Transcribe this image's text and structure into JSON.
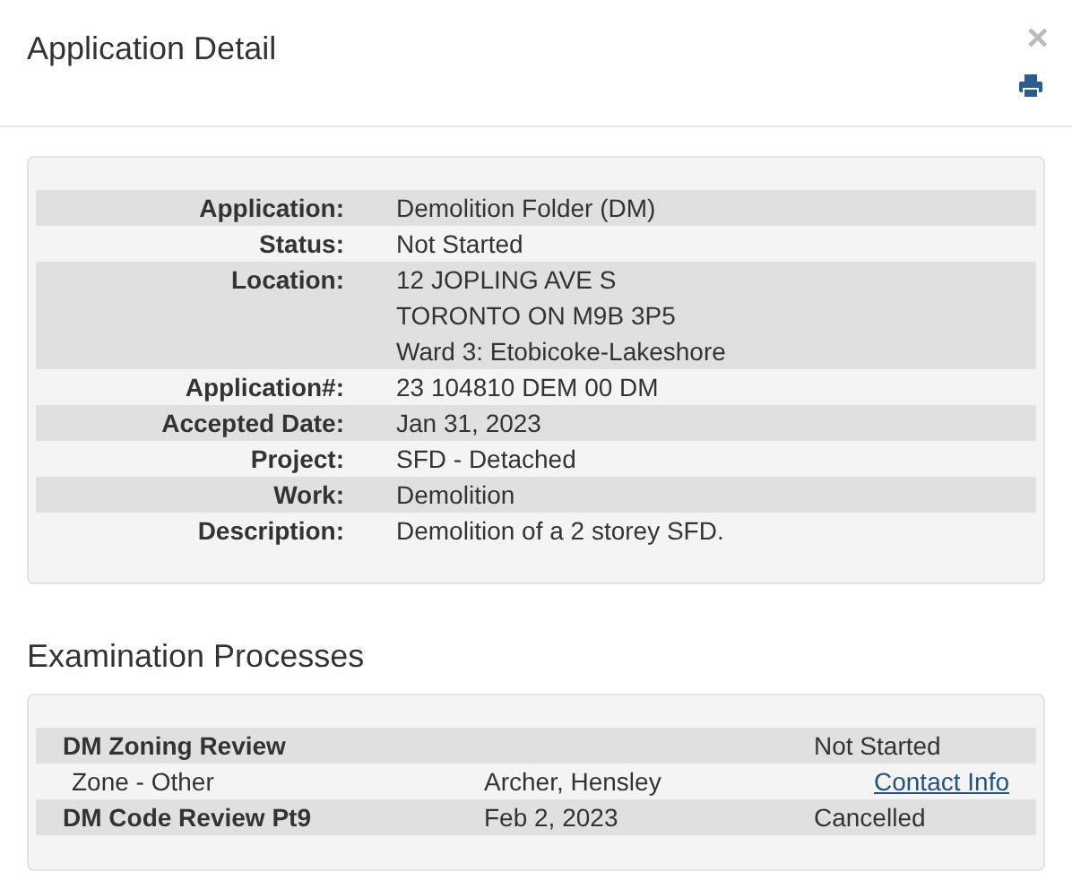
{
  "dialog": {
    "title": "Application Detail",
    "close": "×"
  },
  "details": [
    {
      "label": "Application:",
      "lines": [
        "Demolition Folder (DM)"
      ]
    },
    {
      "label": "Status:",
      "lines": [
        "Not Started"
      ]
    },
    {
      "label": "Location:",
      "lines": [
        "12 JOPLING AVE S",
        "TORONTO ON M9B 3P5",
        "Ward 3: Etobicoke-Lakeshore"
      ]
    },
    {
      "label": "Application#:",
      "lines": [
        "23 104810 DEM 00 DM"
      ]
    },
    {
      "label": "Accepted Date:",
      "lines": [
        "Jan 31, 2023"
      ]
    },
    {
      "label": "Project:",
      "lines": [
        "SFD - Detached"
      ]
    },
    {
      "label": "Work:",
      "lines": [
        "Demolition"
      ]
    },
    {
      "label": "Description:",
      "lines": [
        "Demolition of a 2 storey SFD."
      ]
    }
  ],
  "examination": {
    "heading": "Examination Processes",
    "rows": [
      {
        "kind": "process",
        "name": "DM Zoning Review",
        "status": "Not Started"
      },
      {
        "kind": "task",
        "name": "Zone - Other",
        "reviewer": "Archer, Hensley",
        "link": "Contact Info"
      },
      {
        "kind": "process",
        "name": "DM Code Review Pt9",
        "date": "Feb 2, 2023",
        "status": "Cancelled"
      }
    ]
  }
}
